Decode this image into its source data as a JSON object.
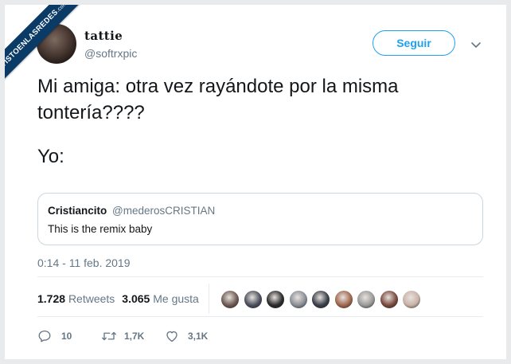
{
  "watermark": {
    "text": "VISTOENLASREDES",
    "suffix": ".com"
  },
  "author": {
    "display_name": "tattie",
    "handle": "@softrxpic"
  },
  "follow_button": {
    "label": "Seguir"
  },
  "tweet": {
    "line1": "Mi amiga: otra vez rayándote por la misma tontería????",
    "line2": "Yo:"
  },
  "quoted_tweet": {
    "name": "Cristiancito",
    "handle": "@mederosCRISTIAN",
    "text": "This is the remix baby"
  },
  "timestamp": "0:14 - 11 feb. 2019",
  "stats": {
    "retweets_count": "1.728",
    "retweets_label": "Retweets",
    "likes_count": "3.065",
    "likes_label": "Me gusta"
  },
  "likers": [
    {
      "color": "#6d5a52"
    },
    {
      "color": "#4b4f5c"
    },
    {
      "color": "#2b2b2b"
    },
    {
      "color": "#8a8f96"
    },
    {
      "color": "#3a3f4a"
    },
    {
      "color": "#a0674f"
    },
    {
      "color": "#9a9a9a"
    },
    {
      "color": "#7a4a3e"
    },
    {
      "color": "#c9b2a8"
    }
  ],
  "actions": {
    "replies": "10",
    "retweets": "1,7K",
    "likes": "3,1K"
  },
  "colors": {
    "accent": "#1da1f2",
    "secondary_text": "#657786",
    "watermark_bg": "#0a3a66"
  },
  "icons": [
    "chevron-down-icon",
    "reply-icon",
    "retweet-icon",
    "heart-icon"
  ]
}
